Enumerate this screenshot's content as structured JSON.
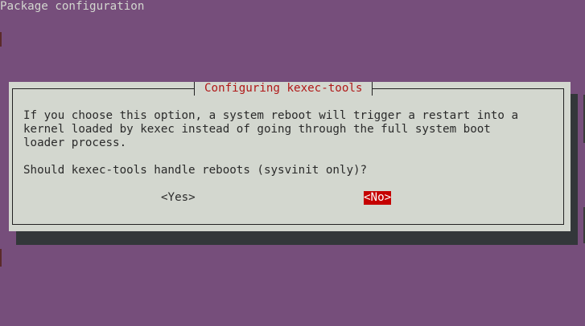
{
  "terminal": {
    "title": "Package configuration"
  },
  "dialog": {
    "title": "Configuring kexec-tools",
    "message": "If you choose this option, a system reboot will trigger a restart into a\nkernel loaded by kexec instead of going through the full system boot\nloader process.",
    "question": "Should kexec-tools handle reboots (sysvinit only)?",
    "buttons": {
      "yes_label": "<Yes>",
      "no_label": "<No>",
      "selected": "no"
    }
  },
  "colors": {
    "background": "#764e7b",
    "dialog_background": "#d3d7cf",
    "title_text": "#b01818",
    "selected_button": "#c50000",
    "shadow": "#33373a"
  }
}
